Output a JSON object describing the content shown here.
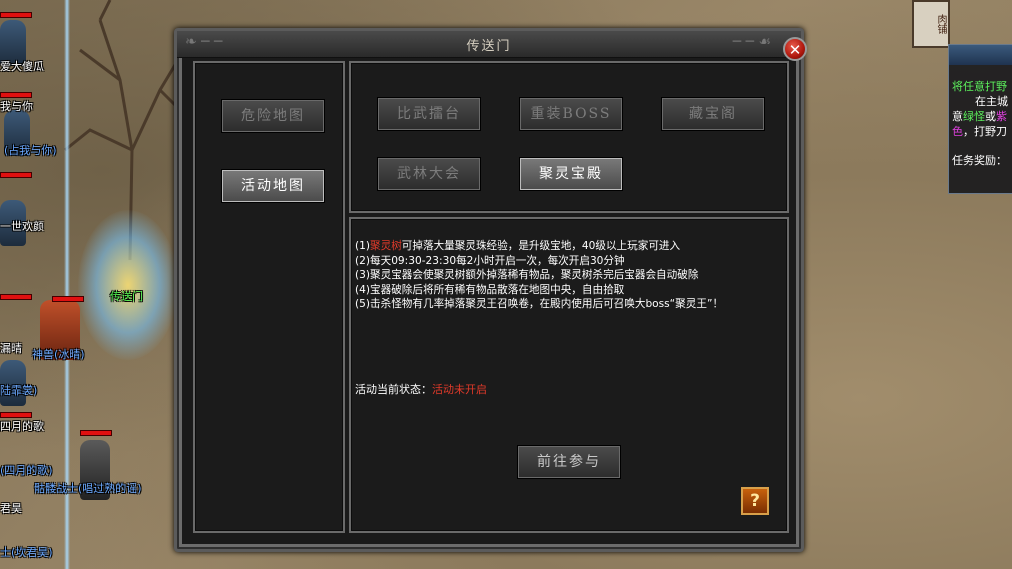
{
  "dialog": {
    "title": "传送门",
    "close_glyph": "✕"
  },
  "left_tabs": [
    {
      "label": "危险地图",
      "active": false
    },
    {
      "label": "活动地图",
      "active": true
    }
  ],
  "event_buttons": [
    {
      "label": "比武擂台",
      "active": false
    },
    {
      "label": "重装BOSS",
      "active": false
    },
    {
      "label": "藏宝阁",
      "active": false
    },
    {
      "label": "武林大会",
      "active": false
    },
    {
      "label": "聚灵宝殿",
      "active": true
    }
  ],
  "rules": {
    "line1_prefix": "(1)",
    "line1_highlight": "聚灵树",
    "line1_rest": "可掉落大量聚灵珠经验，是升级宝地，40级以上玩家可进入",
    "line2": "(2)每天09:30-23:30每2小时开启一次，每次开启30分钟",
    "line3": "(3)聚灵宝器会使聚灵树额外掉落稀有物品，聚灵树杀完后宝器会自动破除",
    "line4": "(4)宝器破除后将所有稀有物品散落在地图中央，自由拾取",
    "line5": "(5)击杀怪物有几率掉落聚灵王召唤卷，在殿内使用后可召唤大boss“聚灵王”！"
  },
  "status": {
    "label": "活动当前状态：",
    "value": "活动未开启"
  },
  "join_button": "前往参与",
  "help_glyph": "?",
  "world": {
    "portal_label": "传送门",
    "names": [
      {
        "text": "爱大傻瓜",
        "color": "white"
      },
      {
        "text": "我与你",
        "color": "white"
      },
      {
        "text": "(占我与你)",
        "color": "blue"
      },
      {
        "text": "一世欢颜",
        "color": "white"
      },
      {
        "text": "漏晴",
        "color": "white"
      },
      {
        "text": "神兽(冰晴)",
        "color": "blue"
      },
      {
        "text": "陆霏裳)",
        "color": "blue"
      },
      {
        "text": "四月的歌",
        "color": "white"
      },
      {
        "text": "(四月的歌)",
        "color": "blue"
      },
      {
        "text": "骷髅战士(唱过熟的谣)",
        "color": "blue"
      },
      {
        "text": "君昊",
        "color": "white"
      },
      {
        "text": "士(坎君昊)",
        "color": "blue"
      }
    ],
    "sign_text": "肉铺"
  },
  "quest": {
    "line1": "将任意打野",
    "line2": "在主城",
    "line3_a": "意",
    "line3_b": "绿怪",
    "line3_c": "或",
    "line3_d": "紫",
    "line4_a": "色",
    "line4_b": "，打野刀",
    "reward_label": "任务奖励："
  }
}
